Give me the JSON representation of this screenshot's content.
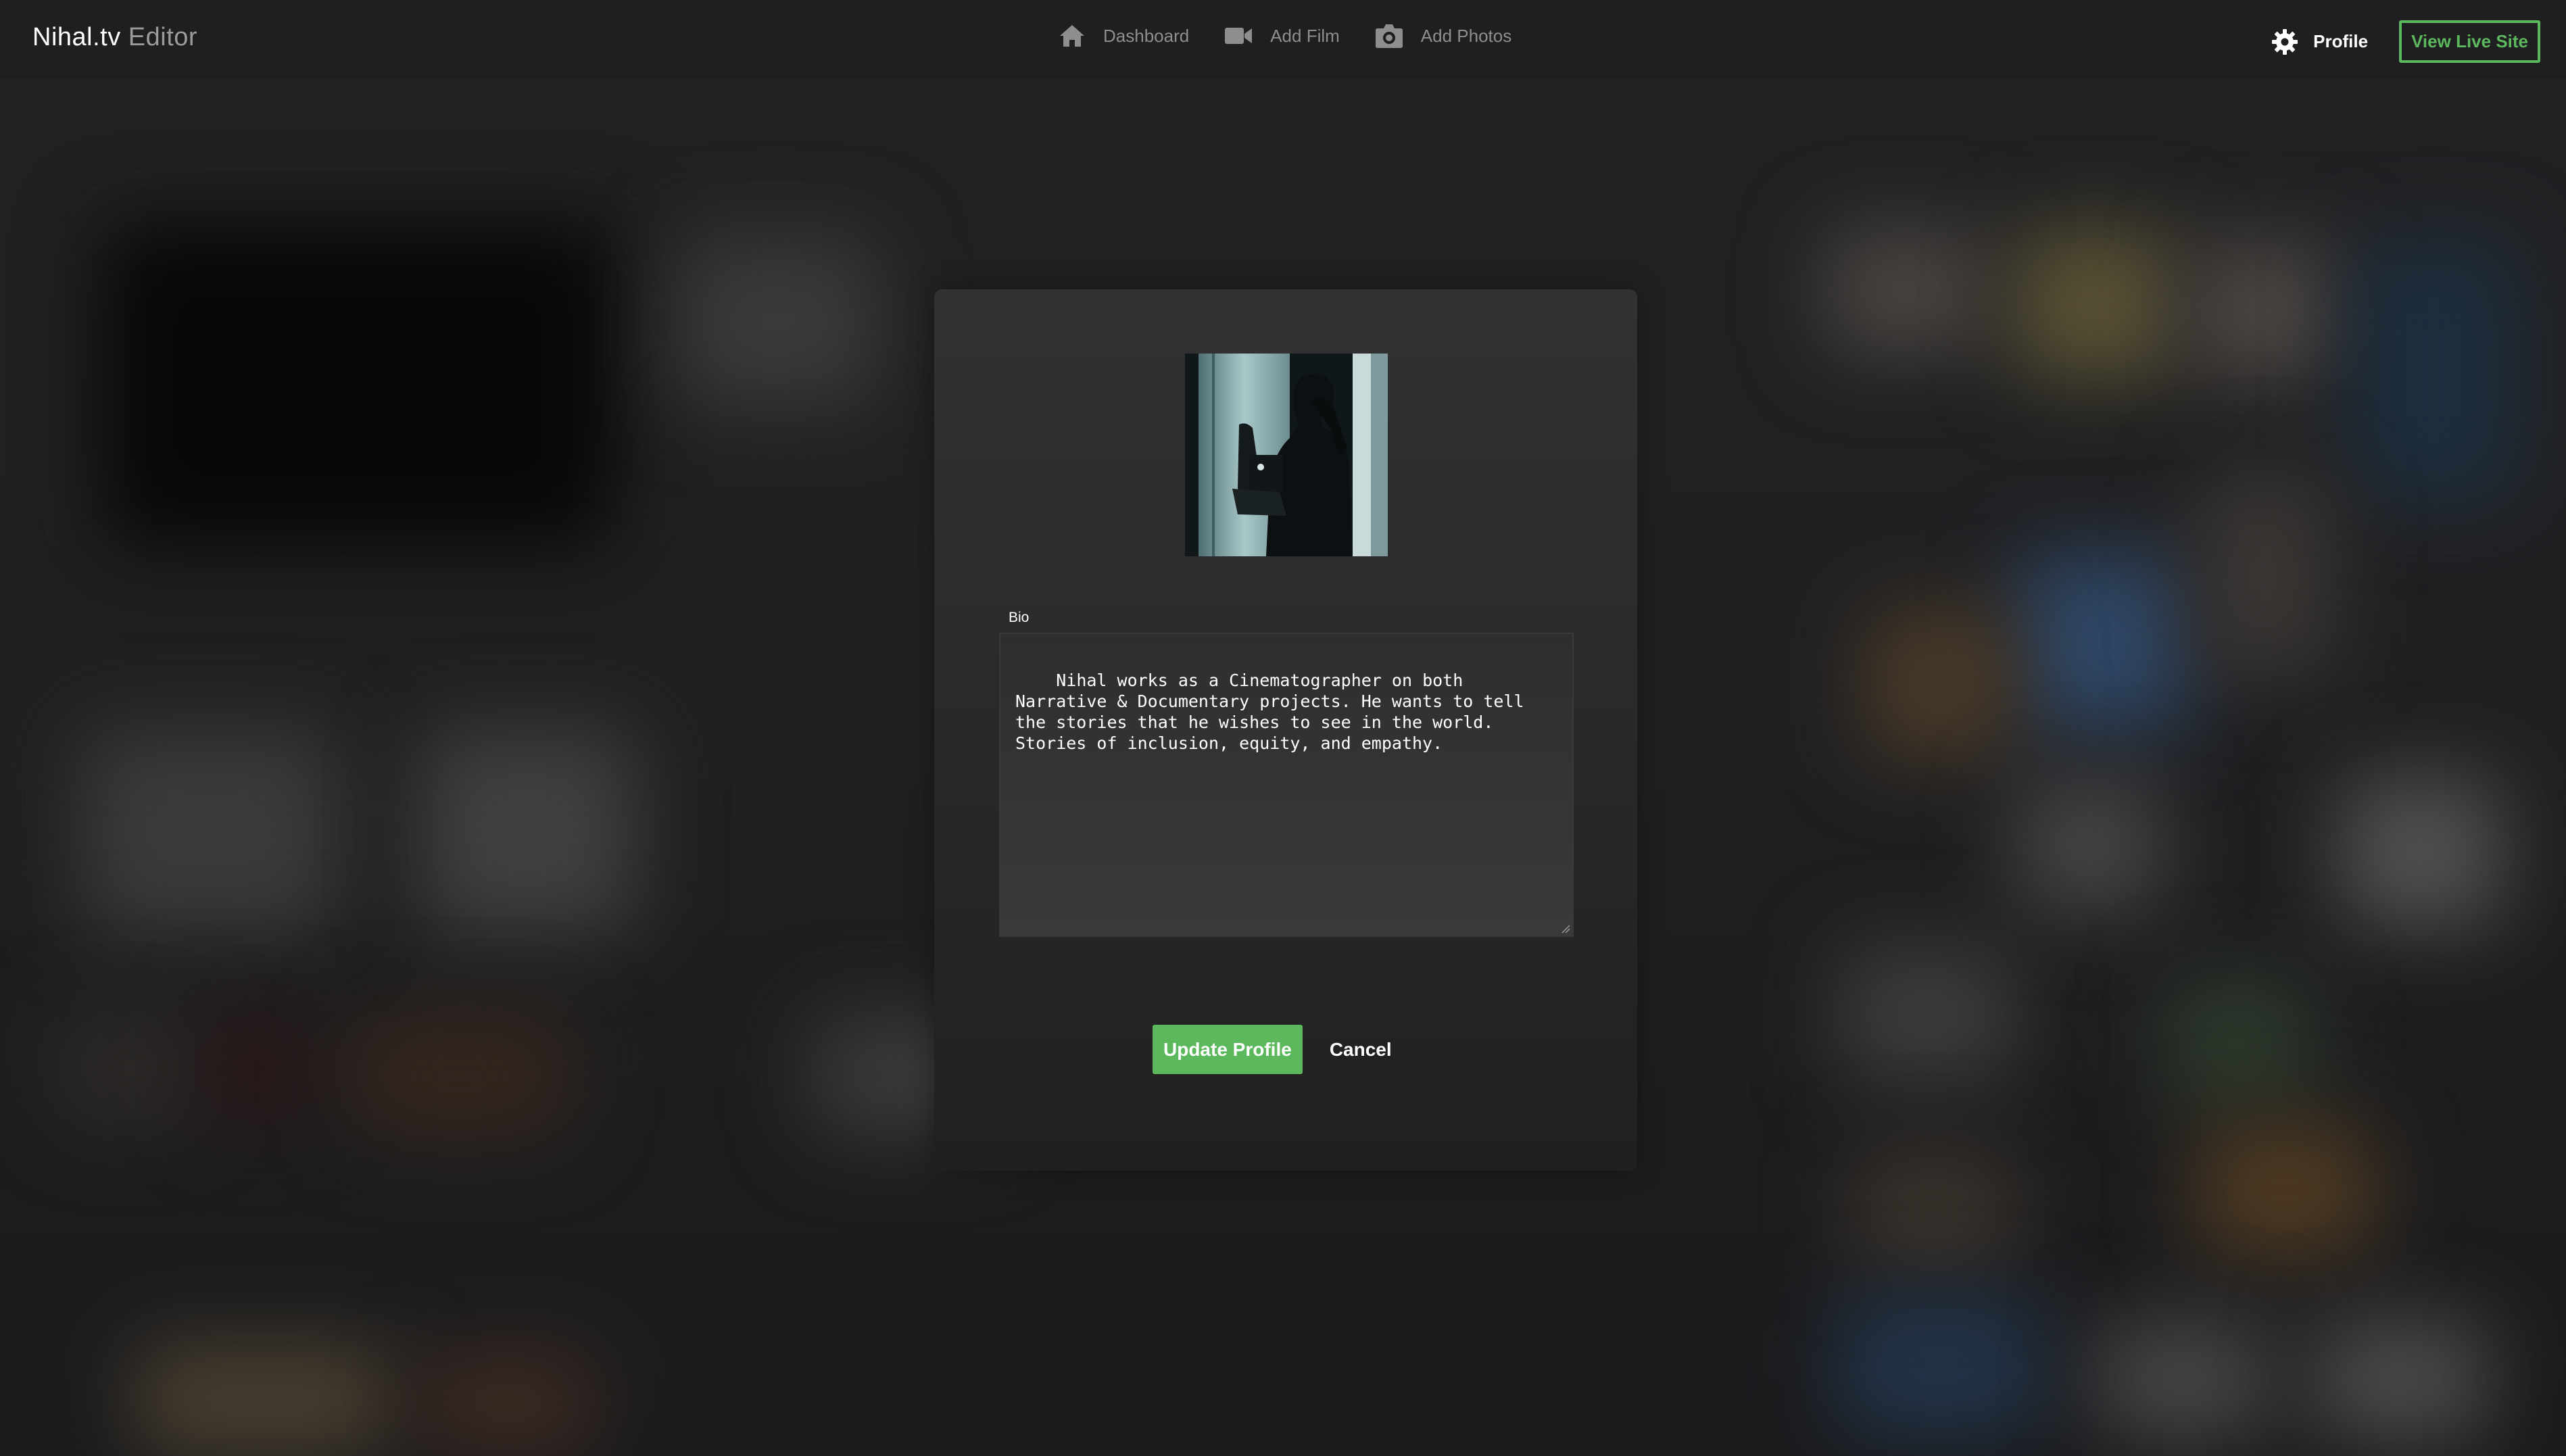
{
  "app": {
    "brand_name": "Nihal.tv",
    "brand_suffix": "Editor"
  },
  "nav": {
    "links": [
      {
        "label": "Dashboard",
        "icon": "home-icon"
      },
      {
        "label": "Add Film",
        "icon": "video-camera-icon"
      },
      {
        "label": "Add Photos",
        "icon": "camera-icon"
      }
    ],
    "profile_label": "Profile",
    "profile_icon": "gear-icon",
    "view_live_site_label": "View Live Site"
  },
  "profile_modal": {
    "avatar_alt": "profile-photo",
    "bio_label": "Bio",
    "bio_value": "Nihal works as a Cinematographer on both Narrative & Documentary projects. He wants to tell the stories that he wishes to see in the world. Stories of inclusion, equity, and empathy.",
    "update_button_label": "Update Profile",
    "cancel_button_label": "Cancel"
  },
  "colors": {
    "accent_green": "#5cb85c",
    "background": "#1f1f21",
    "modal_background": "#2c2c2e"
  }
}
